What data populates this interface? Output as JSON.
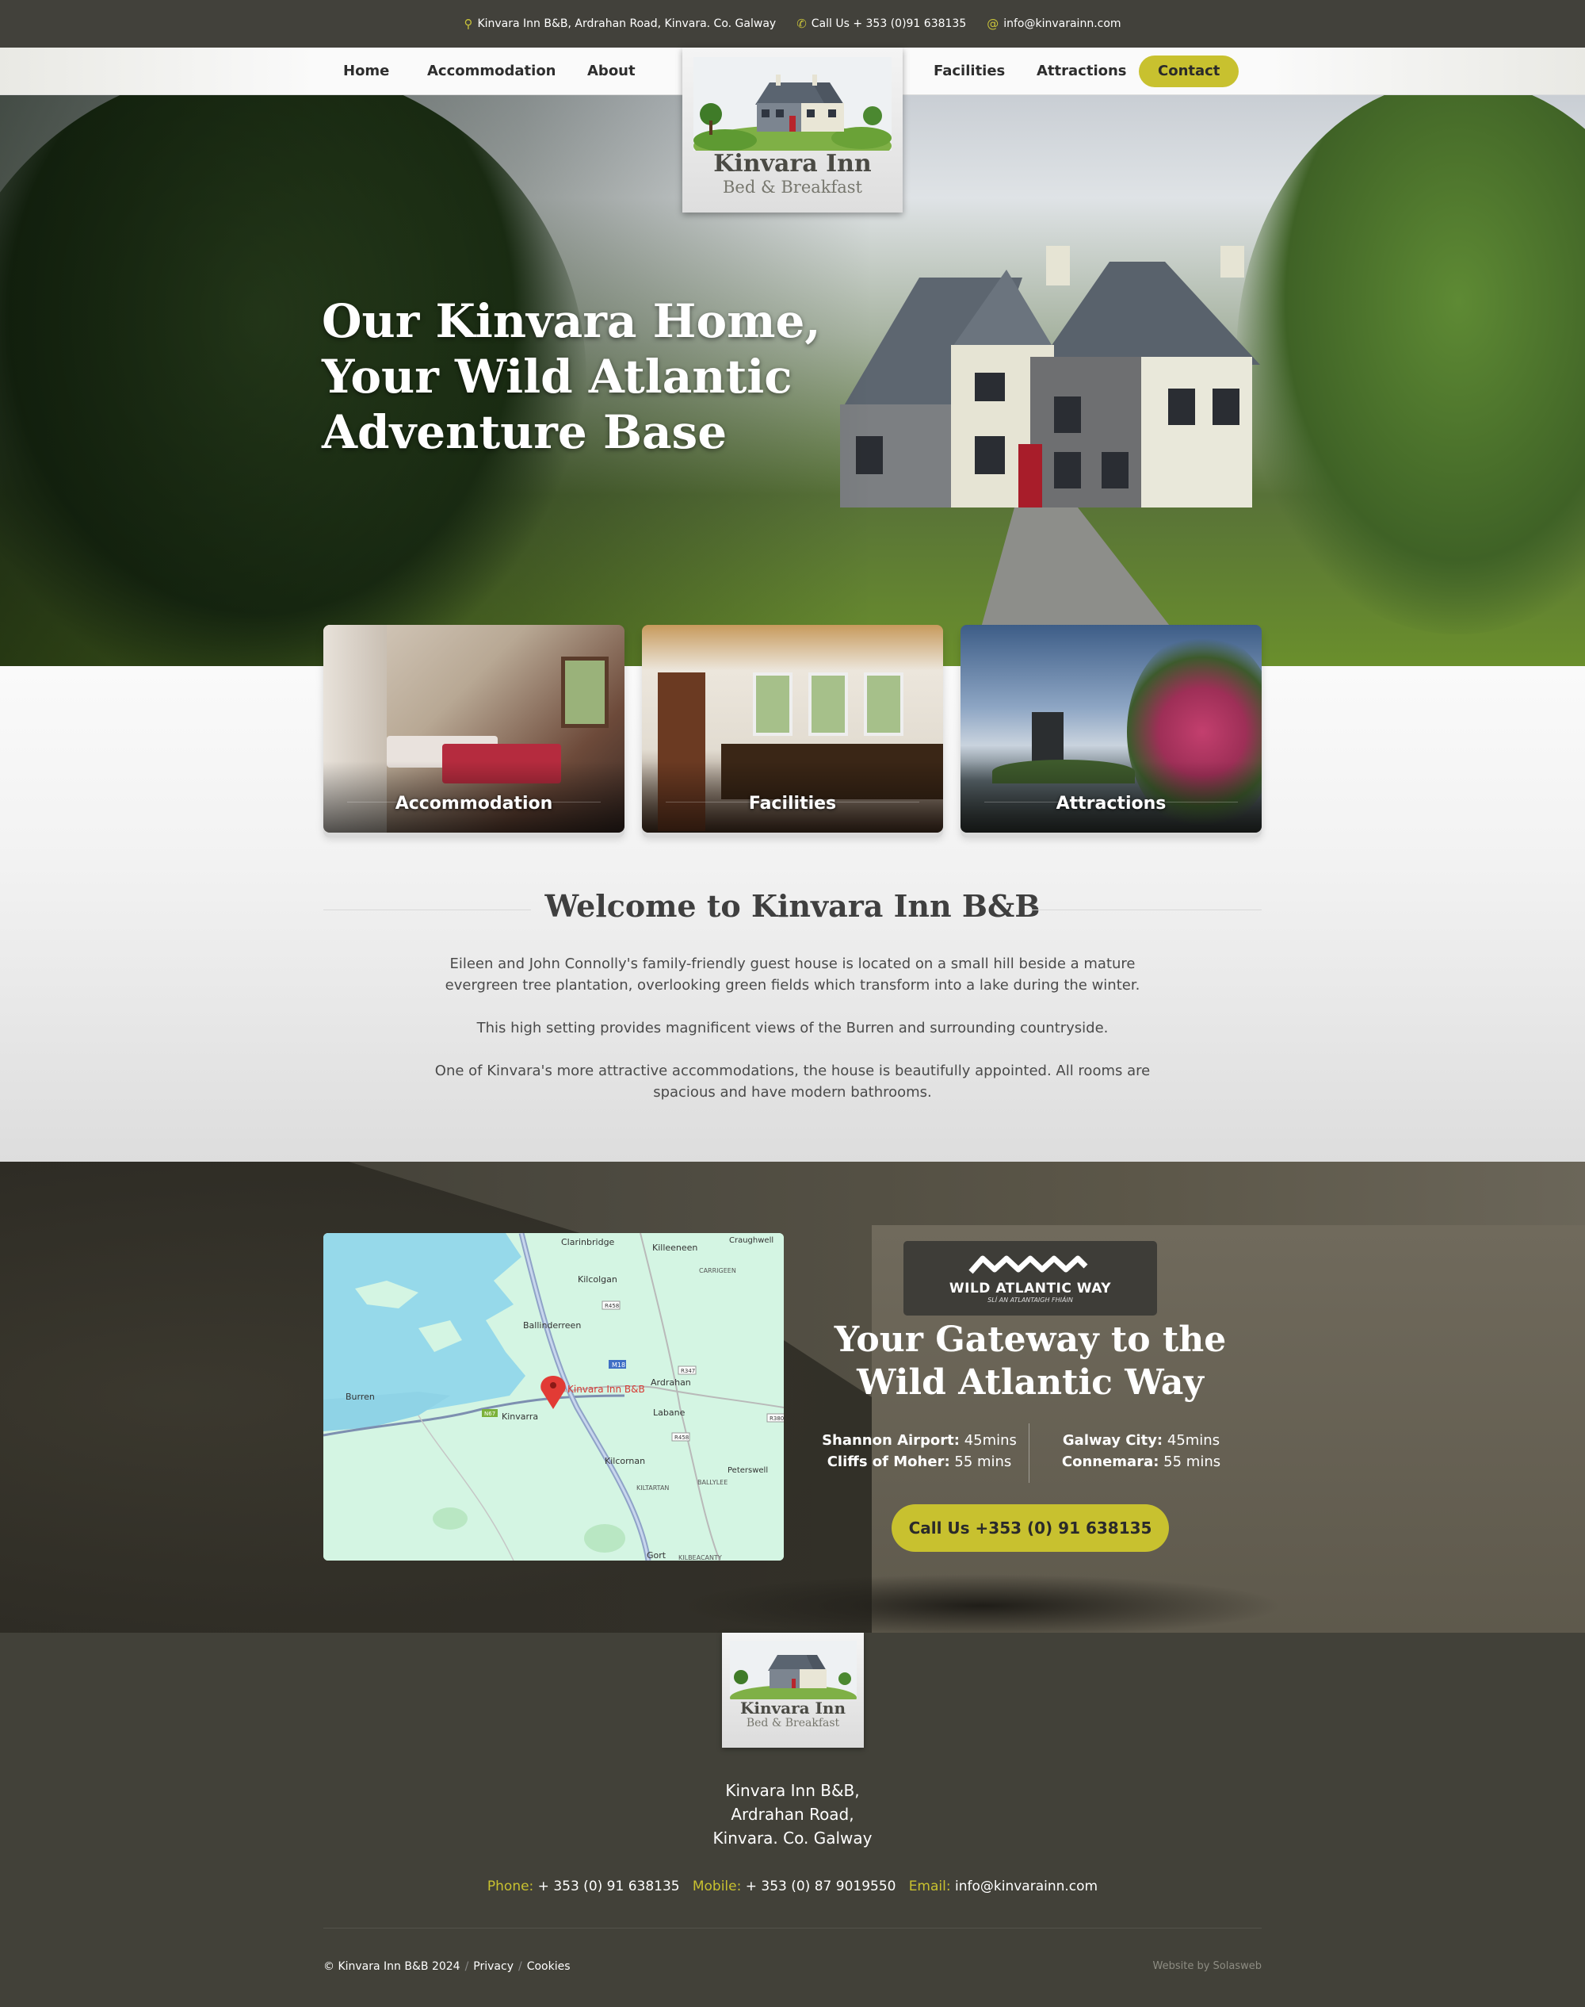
{
  "topbar": {
    "address": "Kinvara Inn B&B, Ardrahan Road, Kinvara. Co. Galway",
    "phone": "Call Us + 353 (0)91 638135",
    "email": "info@kinvarainn.com"
  },
  "nav": {
    "home": "Home",
    "accommodation": "Accommodation",
    "about": "About",
    "facilities": "Facilities",
    "attractions": "Attractions",
    "contact": "Contact"
  },
  "logo": {
    "line1": "Kinvara Inn",
    "line2": "Bed & Breakfast"
  },
  "hero": {
    "headline": "Our Kinvara Home, Your Wild Atlantic Adventure Base"
  },
  "cards": [
    {
      "label": "Accommodation"
    },
    {
      "label": "Facilities"
    },
    {
      "label": "Attractions"
    }
  ],
  "welcome": {
    "title": "Welcome to Kinvara Inn B&B",
    "p1": "Eileen and John Connolly's family-friendly guest house is located on a small hill beside a mature evergreen tree plantation, overlooking green fields which transform into a lake during the winter.",
    "p2": "This high setting provides magnificent views of the Burren and surrounding countryside.",
    "p3": "One of Kinvara's more attractive accommodations, the house is beautifully appointed.  All rooms are spacious and have modern bathrooms."
  },
  "map": {
    "places": [
      "Clarinbridge",
      "Killeeneen",
      "Craughwell",
      "CARRIGEEN",
      "Kilcolgan",
      "Ballinderreen",
      "Ardrahan",
      "Labane",
      "Burren",
      "Kinvarra",
      "Kilcornan",
      "Peterswell",
      "KILTARTAN",
      "BALLYLEE",
      "Gort",
      "KILBEACANTY"
    ],
    "roads": [
      "R458",
      "M18",
      "R347",
      "R458",
      "R380",
      "N67"
    ],
    "marker_label": "Kinvara Inn B&B"
  },
  "wild_atlantic": {
    "logo_main": "WILD ATLANTIC WAY",
    "logo_sub": "SLÍ AN ATLANTAIGH FHIÁIN",
    "title": "Your Gateway to the Wild Atlantic Way",
    "shannon_k": "Shannon Airport:",
    "shannon_v": " 45mins",
    "cliffs_k": "Cliffs of Moher:",
    "cliffs_v": " 55 mins",
    "galway_k": "Galway City:",
    "galway_v": " 45mins",
    "connemara_k": "Connemara:",
    "connemara_v": " 55 mins",
    "call_button": "Call Us +353 (0) 91 638135"
  },
  "footer": {
    "addr1": "Kinvara Inn B&B,",
    "addr2": "Ardrahan Road,",
    "addr3": "Kinvara. Co. Galway",
    "phone_k": "Phone:",
    "phone_v": " + 353 (0) 91 638135",
    "mobile_k": "Mobile:",
    "mobile_v": " + 353 (0) 87 9019550",
    "email_k": "Email:",
    "email_v": " info@kinvarainn.com",
    "copyright": "© Kinvara Inn B&B 2024",
    "privacy": "Privacy",
    "cookies": "Cookies",
    "credit": "Website by Solasweb"
  },
  "colors": {
    "accent": "#c8c12f",
    "dark": "#42413b"
  }
}
